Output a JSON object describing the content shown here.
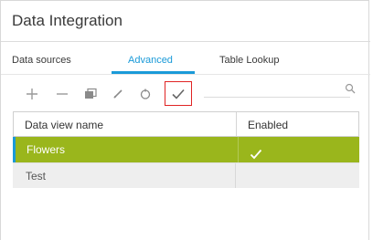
{
  "panel": {
    "title": "Data Integration"
  },
  "tabs": [
    {
      "label": "Data sources",
      "active": false
    },
    {
      "label": "Advanced",
      "active": true
    },
    {
      "label": "Table Lookup",
      "active": false
    }
  ],
  "toolbar": {
    "icons": [
      "plus-icon",
      "minus-icon",
      "duplicate-icon",
      "edit-pencil-icon",
      "refresh-icon",
      "check-icon",
      "search-icon"
    ],
    "highlighted": "check-icon"
  },
  "table": {
    "columns": [
      "Data view name",
      "Enabled"
    ],
    "rows": [
      {
        "name": "Flowers",
        "enabled": true,
        "selected": true
      },
      {
        "name": "Test",
        "enabled": false,
        "selected": false
      }
    ]
  },
  "colors": {
    "accent": "#1a9ad8",
    "selected_row": "#9ab61c",
    "highlight_border": "#e02424"
  }
}
